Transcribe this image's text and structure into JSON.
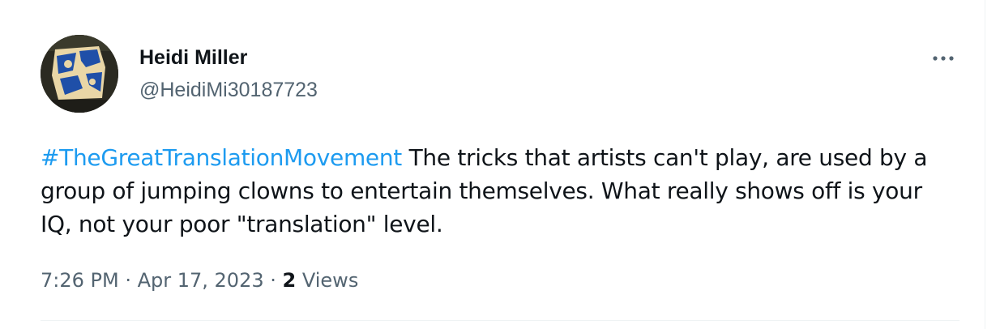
{
  "tweet": {
    "author": {
      "display_name": "Heidi Miller",
      "handle": "@HeidiMi30187723"
    },
    "hashtag": "#TheGreatTranslationMovement",
    "body_text": " The tricks that artists can't play, are used by a group of jumping clowns to entertain themselves. What really shows off is your IQ, not your poor \"translation\" level.",
    "time": "7:26 PM",
    "separator": " · ",
    "date": "Apr 17, 2023",
    "views_count": "2",
    "views_label": "Views"
  },
  "icons": {
    "more": "more-horizontal-icon"
  },
  "colors": {
    "link": "#1d9bf0",
    "secondary_text": "#536471",
    "primary_text": "#0f1419"
  }
}
